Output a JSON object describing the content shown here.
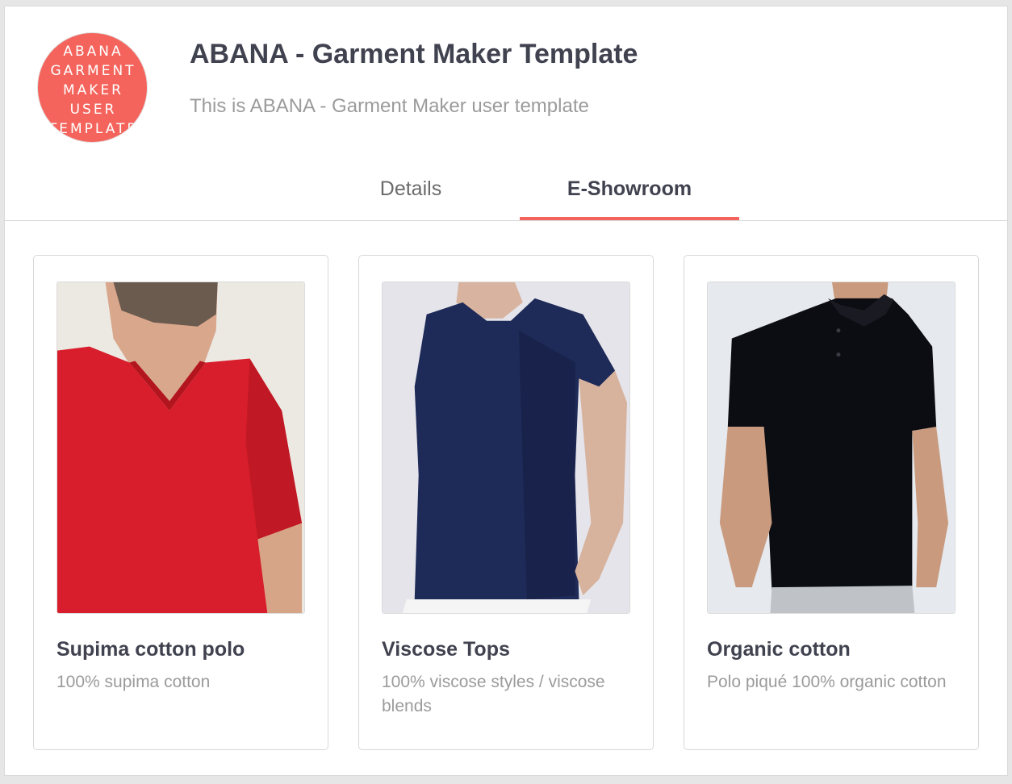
{
  "header": {
    "logo_lines": [
      "ABANA",
      "GARMENT",
      "MAKER",
      "USER",
      "TEMPLATE"
    ],
    "title": "ABANA - Garment Maker Template",
    "subtitle": "This is ABANA - Garment Maker user template"
  },
  "tabs": [
    {
      "label": "Details",
      "active": false
    },
    {
      "label": "E-Showroom",
      "active": true
    }
  ],
  "products": [
    {
      "title": "Supima cotton polo",
      "description": "100% supima cotton",
      "garment_color": "#d81e2c"
    },
    {
      "title": "Viscose Tops",
      "description": "100% viscose styles / viscose blends",
      "garment_color": "#1e2a57"
    },
    {
      "title": "Organic cotton",
      "description": "Polo piqué 100% organic cotton",
      "garment_color": "#0c0d12"
    }
  ],
  "colors": {
    "accent": "#f4645c",
    "title_text": "#40424f",
    "muted_text": "#9b9b9b"
  }
}
